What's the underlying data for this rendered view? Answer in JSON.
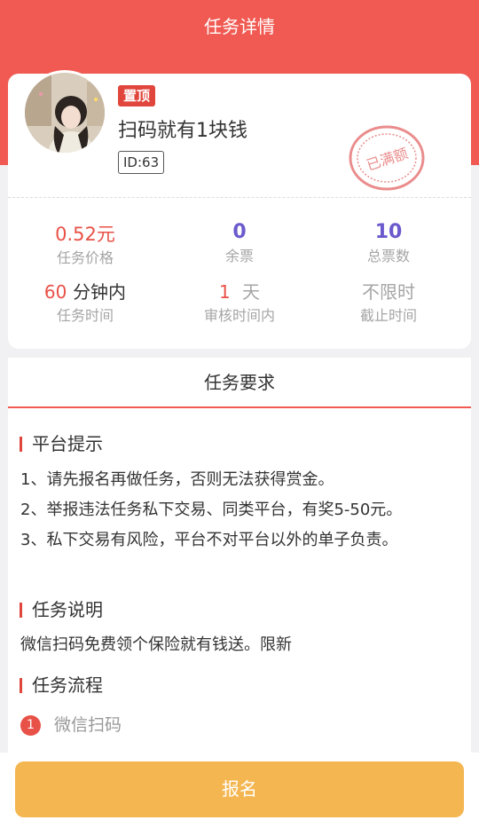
{
  "header": {
    "title": "任务详情"
  },
  "task": {
    "badge": "置顶",
    "title": "扫码就有1块钱",
    "id_label": "ID:63",
    "stamp_text": "已满额",
    "stats": {
      "price_value": "0.52元",
      "price_label": "任务价格",
      "remaining_value": "0",
      "remaining_label": "余票",
      "total_value": "10",
      "total_label": "总票数",
      "time_value": "60",
      "time_unit": "分钟内",
      "time_label": "任务时间",
      "review_value": "1",
      "review_unit": "天",
      "review_label": "审核时间内",
      "deadline_value": "不限时",
      "deadline_label": "截止时间"
    }
  },
  "requirements": {
    "title": "任务要求",
    "platform_tips_heading": "平台提示",
    "tips": [
      "1、请先报名再做任务，否则无法获得赏金。",
      "2、举报违法任务私下交易、同类平台，有奖5-50元。",
      "3、私下交易有风险，平台不对平台以外的单子负责。"
    ],
    "description_heading": "任务说明",
    "description": "微信扫码免费领个保险就有钱送。限新",
    "process_heading": "任务流程",
    "steps": [
      {
        "number": "1",
        "text": "微信扫码"
      }
    ]
  },
  "actions": {
    "signup_label": "报名"
  },
  "colors": {
    "brand_red": "#f05a52",
    "accent_purple": "#6a5acd",
    "button_orange": "#f4b650"
  }
}
